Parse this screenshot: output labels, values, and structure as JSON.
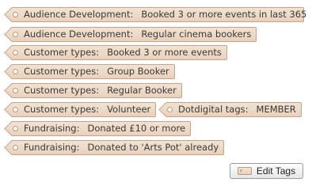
{
  "tags": [
    {
      "category": "Audience Development:",
      "value": "Booked 3 or more events in last 365"
    },
    {
      "category": "Audience Development:",
      "value": "Regular cinema bookers"
    },
    {
      "category": "Customer types:",
      "value": "Booked 3 or more events"
    },
    {
      "category": "Customer types:",
      "value": "Group Booker"
    },
    {
      "category": "Customer types:",
      "value": "Regular Booker"
    },
    {
      "category": "Customer types:",
      "value": "Volunteer"
    },
    {
      "category": "Dotdigital tags:",
      "value": "MEMBER"
    },
    {
      "category": "Fundraising:",
      "value": "Donated £10 or more"
    },
    {
      "category": "Fundraising:",
      "value": "Donated to 'Arts Pot' already"
    }
  ],
  "actions": {
    "edit_tags_label": "Edit Tags",
    "edit_tags_icon": "tag-icon"
  },
  "colors": {
    "tag_background": "#eedbc7",
    "tag_border": "#c4a58a",
    "text": "#3a3a3a"
  }
}
